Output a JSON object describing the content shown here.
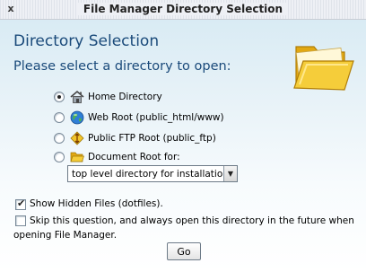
{
  "window": {
    "title": "File Manager Directory Selection",
    "close_glyph": "x"
  },
  "main": {
    "heading": "Directory Selection",
    "prompt": "Please select a directory to open:"
  },
  "options": [
    {
      "label": "Home Directory",
      "icon": "home-icon",
      "selected": true
    },
    {
      "label": "Web Root (public_html/www)",
      "icon": "globe-icon",
      "selected": false
    },
    {
      "label": "Public FTP Root (public_ftp)",
      "icon": "ftp-icon",
      "selected": false
    },
    {
      "label": "Document Root for:",
      "icon": "folder-icon",
      "selected": false
    }
  ],
  "doc_root_select": {
    "value": "top level directory for installations"
  },
  "show_hidden": {
    "label": "Show Hidden Files (dotfiles).",
    "checked": true
  },
  "skip_question": {
    "line1": "Skip this question, and always open this directory in the future when",
    "line2": "opening File Manager.",
    "checked": false
  },
  "go_button": {
    "label": "Go"
  },
  "colors": {
    "heading": "#1a4a7a",
    "panel_top": "#d9ebf4",
    "folder": "#f2c42a"
  }
}
